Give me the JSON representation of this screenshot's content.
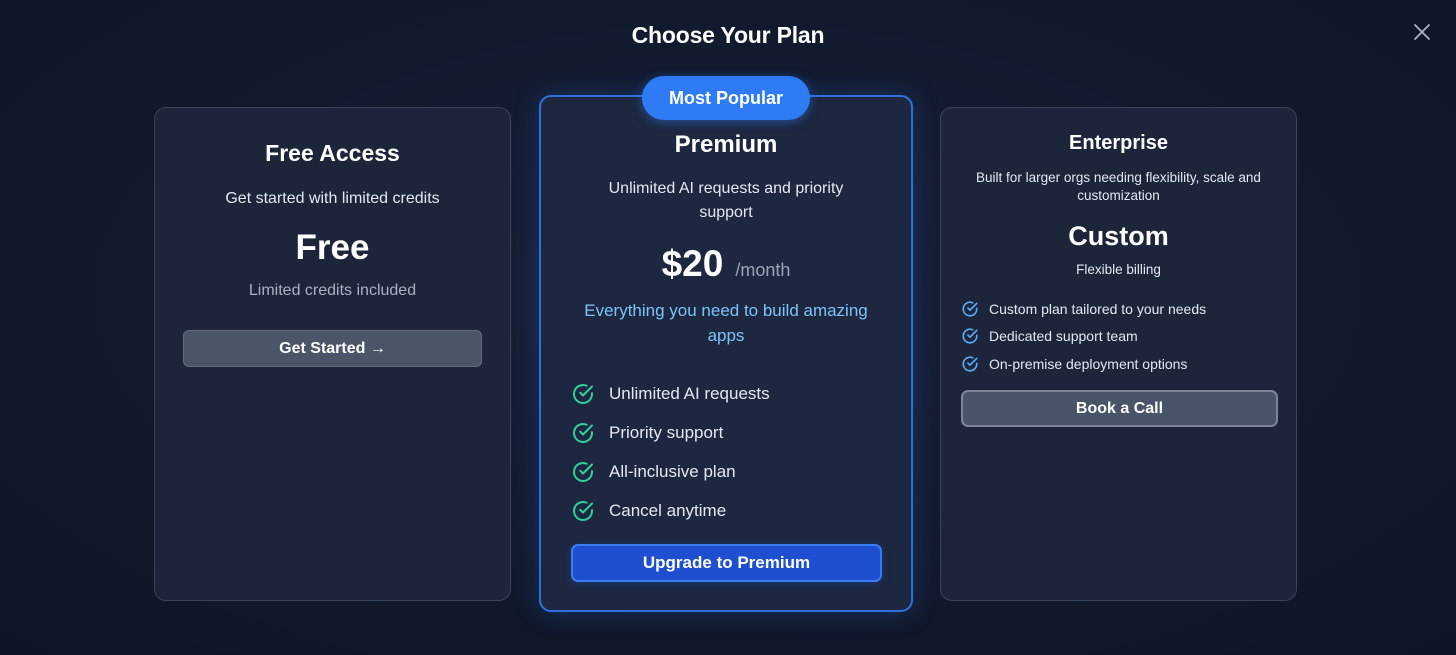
{
  "modal": {
    "title": "Choose Your Plan",
    "close_icon": "close-icon"
  },
  "colors": {
    "background": "#121a2e",
    "card": "#1c2539",
    "accent": "#2f7bf5",
    "premium_border": "#2f6fe0",
    "tagline": "#7cc4f8",
    "check_green": "#2fd39a",
    "check_blue": "#5aa9f5"
  },
  "plans": {
    "free": {
      "name": "Free Access",
      "description": "Get started with limited credits",
      "price": "Free",
      "price_note": "Limited credits included",
      "button_label": "Get Started →"
    },
    "premium": {
      "badge": "Most Popular",
      "name": "Premium",
      "description": "Unlimited AI requests and priority support",
      "price": "$20",
      "period": "/month",
      "tagline": "Everything you need to build amazing apps",
      "features": [
        "Unlimited AI requests",
        "Priority support",
        "All-inclusive plan",
        "Cancel anytime"
      ],
      "feature_icon": "check-circle-icon",
      "button_label": "Upgrade to Premium"
    },
    "enterprise": {
      "name": "Enterprise",
      "description": "Built for larger orgs needing flexibility, scale and customization",
      "price": "Custom",
      "price_note": "Flexible billing",
      "features": [
        "Custom plan tailored to your needs",
        "Dedicated support team",
        "On-premise deployment options"
      ],
      "feature_icon": "check-circle-icon",
      "button_label": "Book a Call"
    }
  }
}
